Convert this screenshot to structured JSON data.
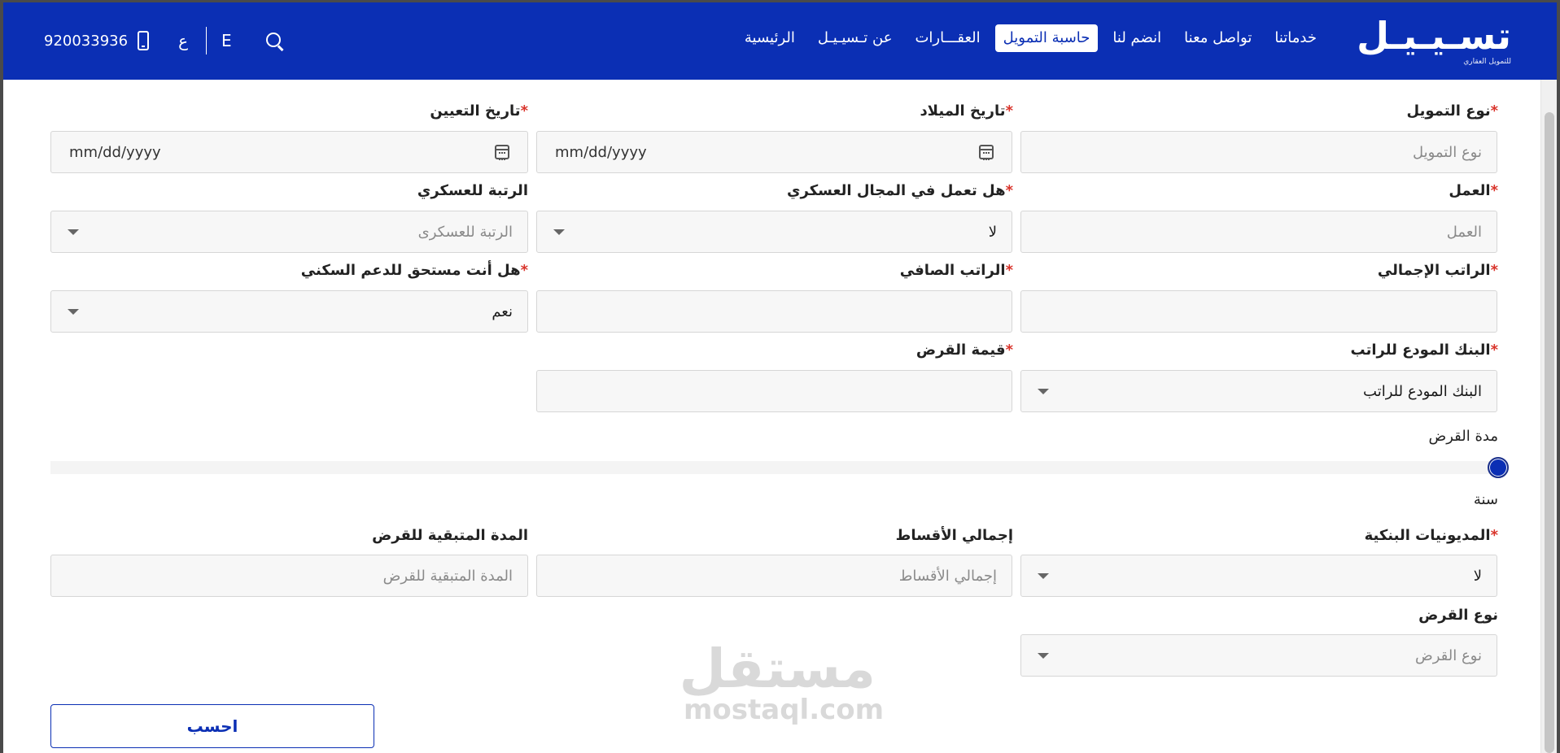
{
  "header": {
    "logo_text": "تسـيـيـل",
    "logo_subtext": "للتمويل العقاري",
    "nav": [
      {
        "label": "الرئيسية",
        "active": false
      },
      {
        "label": "عن تـسيـيـل",
        "active": false
      },
      {
        "label": "العقـــارات",
        "active": false
      },
      {
        "label": "حاسبة التمويل",
        "active": true
      },
      {
        "label": "انضم لنا",
        "active": false
      },
      {
        "label": "تواصل معنا",
        "active": false
      },
      {
        "label": "خدماتنا",
        "active": false
      }
    ],
    "phone": "920033936",
    "lang_ar": "ع",
    "lang_en": "E",
    "brand_color": "#0b2fb4"
  },
  "form": {
    "finance_type": {
      "label": "نوع التمويل",
      "placeholder": "نوع التمويل"
    },
    "birth_date": {
      "label": "تاريخ الميلاد",
      "value": "mm/dd/yyyy"
    },
    "hire_date": {
      "label": "تاريخ التعيين",
      "value": "mm/dd/yyyy"
    },
    "job": {
      "label": "العمل",
      "placeholder": "العمل"
    },
    "military": {
      "label": "هل تعمل في المجال العسكري",
      "value": "لا"
    },
    "military_rank": {
      "label": "الرتبة للعسكري",
      "placeholder": "الرتبة للعسكرى"
    },
    "gross_salary": {
      "label": "الراتب الإجمالي",
      "value": ""
    },
    "net_salary": {
      "label": "الراتب الصافي",
      "value": ""
    },
    "housing_support": {
      "label": "هل أنت مستحق للدعم السكني",
      "value": "نعم"
    },
    "salary_bank": {
      "label": "البنك المودع للراتب",
      "value": "البنك المودع للراتب"
    },
    "loan_amount": {
      "label": "قيمة القرض",
      "value": ""
    },
    "loan_duration": {
      "label": "مدة القرض",
      "unit": "سنة",
      "level": 0
    },
    "bank_debts": {
      "label": "المديونيات البنكية",
      "value": "لا"
    },
    "total_installments": {
      "label": "إجمالي الأقساط",
      "placeholder": "إجمالي الأقساط"
    },
    "remaining_term": {
      "label": "المدة المتبقية للقرض",
      "placeholder": "المدة المتبقية للقرض"
    },
    "loan_type": {
      "label": "نوع القرض",
      "placeholder": "نوع القرض"
    },
    "required_mark": "*",
    "calculate_label": "احسب"
  },
  "watermark": {
    "ar": "مستقل",
    "en": "mostaql.com"
  }
}
